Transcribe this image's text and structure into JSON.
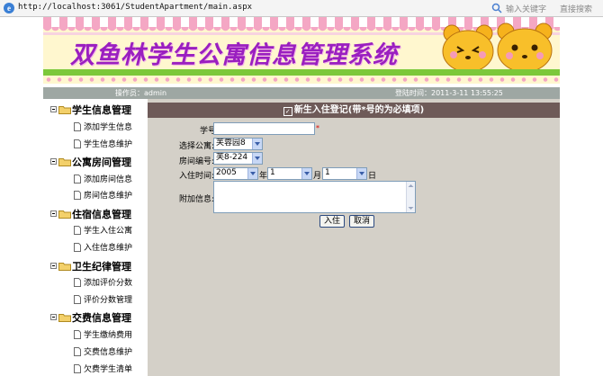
{
  "browser": {
    "url": "http://localhost:3061/StudentApartment/main.aspx",
    "search_placeholder": "输入关键字",
    "search_go": "直接搜索",
    "ie_letter": "e"
  },
  "banner": {
    "title": "双鱼林学生公寓信息管理系统"
  },
  "infobar": {
    "operator": "操作员：admin",
    "login_time": "登陆时间：2011-3-11 13:55:25"
  },
  "sidebar": {
    "groups": [
      {
        "label": "学生信息管理",
        "items": [
          "添加学生信息",
          "学生信息维护"
        ]
      },
      {
        "label": "公寓房间管理",
        "items": [
          "添加房间信息",
          "房间信息维护"
        ]
      },
      {
        "label": "住宿信息管理",
        "items": [
          "学生入住公寓",
          "入住信息维护"
        ]
      },
      {
        "label": "卫生纪律管理",
        "items": [
          "添加评价分数",
          "评价分数管理"
        ]
      },
      {
        "label": "交费信息管理",
        "items": [
          "学生缴纳费用",
          "交费信息维护",
          "欠费学生清单"
        ]
      }
    ]
  },
  "form": {
    "heading": "新生入住登记(带*号的为必填项)",
    "student_id_label": "学号:",
    "student_id_value": "",
    "required_mark": "*",
    "apartment_label": "选择公寓:",
    "apartment_value": "芙蓉园8",
    "room_label": "房间编号:",
    "room_value": "芙8-224",
    "date_label": "入住时间:",
    "year_value": "2005",
    "year_unit": "年",
    "month_value": "1",
    "month_unit": "月",
    "day_value": "1",
    "day_unit": "日",
    "extra_label": "附加信息:",
    "extra_value": "",
    "submit_label": "入住",
    "cancel_label": "取消"
  }
}
